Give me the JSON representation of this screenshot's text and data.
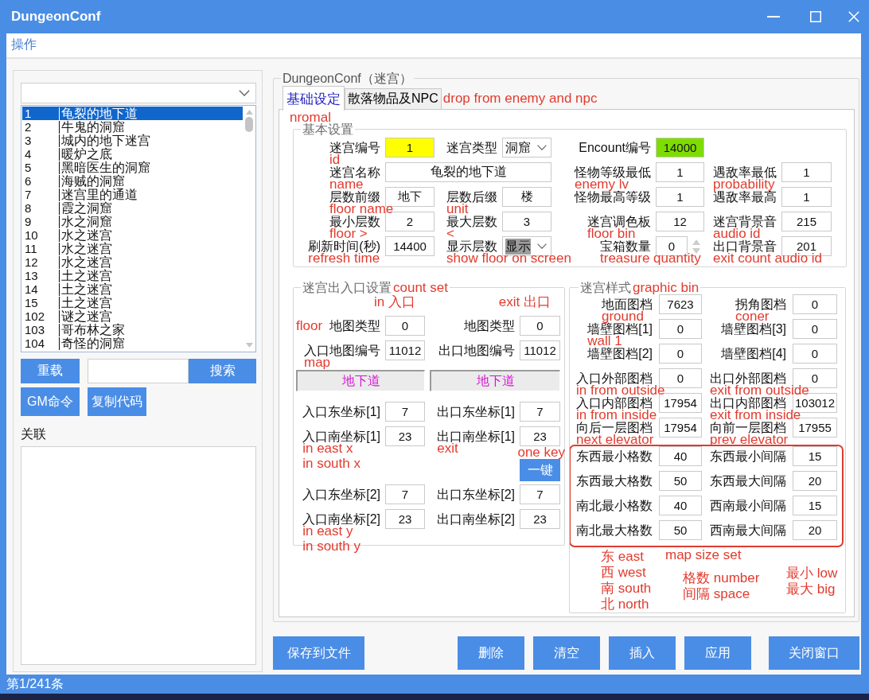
{
  "window": {
    "title": "DungeonConf"
  },
  "menu": [
    {
      "label": "操作"
    }
  ],
  "dungeon_list": {
    "rows": [
      {
        "id": "1",
        "name": "龟裂的地下道",
        "selected": true
      },
      {
        "id": "2",
        "name": "牛鬼的洞窟",
        "selected": false
      },
      {
        "id": "3",
        "name": "城内的地下迷宫",
        "selected": false
      },
      {
        "id": "4",
        "name": "暖炉之底",
        "selected": false
      },
      {
        "id": "5",
        "name": "黑暗医生的洞窟",
        "selected": false
      },
      {
        "id": "6",
        "name": "海贼的洞窟",
        "selected": false
      },
      {
        "id": "7",
        "name": "迷宫里的通道",
        "selected": false
      },
      {
        "id": "8",
        "name": "霞之洞窟",
        "selected": false
      },
      {
        "id": "9",
        "name": "水之洞窟",
        "selected": false
      },
      {
        "id": "10",
        "name": "水之迷宫",
        "selected": false
      },
      {
        "id": "11",
        "name": "水之迷宫",
        "selected": false
      },
      {
        "id": "12",
        "name": "水之迷宫",
        "selected": false
      },
      {
        "id": "13",
        "name": "土之迷宫",
        "selected": false
      },
      {
        "id": "14",
        "name": "土之迷宫",
        "selected": false
      },
      {
        "id": "15",
        "name": "土之迷宫",
        "selected": false
      },
      {
        "id": "102",
        "name": "谜之迷宫",
        "selected": false
      },
      {
        "id": "103",
        "name": "哥布林之家",
        "selected": false
      },
      {
        "id": "104",
        "name": "奇怪的洞窟",
        "selected": false
      }
    ]
  },
  "list_controls": {
    "reload": "重载",
    "search_button": "搜索",
    "buttons": [
      "GM命令",
      "复制代码"
    ]
  },
  "related": {
    "label": "关联"
  },
  "config": {
    "title": "DungeonConf（迷宫）",
    "tabs": [
      {
        "label": "基础设定",
        "selected": true,
        "notes": [
          "nromal"
        ]
      },
      {
        "label": "散落物品及NPC",
        "selected": false,
        "notes": [
          "drop from enemy and npc"
        ]
      }
    ],
    "basic": {
      "title": "基本设置",
      "rows": [
        {
          "left": [
            {
              "kind": "text",
              "label": "迷宫编号",
              "value": "1",
              "color": "#ffff00",
              "notes": [
                "id"
              ]
            },
            {
              "kind": "combo",
              "label": "迷宫类型",
              "value": "洞窟",
              "highlighted": false
            }
          ],
          "right": [
            {
              "kind": "text",
              "label": "Encount编号",
              "value": "14000",
              "color": "#7fdc00"
            }
          ]
        },
        {
          "left": [
            {
              "kind": "wide",
              "label": "迷宫名称",
              "value": "龟裂的地下道",
              "notes": [
                "name"
              ]
            }
          ],
          "right": [
            {
              "kind": "text",
              "label": "怪物等级最低",
              "value": "1",
              "notes": [
                "enemy lv"
              ]
            },
            {
              "kind": "text",
              "label": "遇敌率最低",
              "value": "1",
              "notes": [
                "probability"
              ]
            }
          ]
        },
        {
          "left": [
            {
              "kind": "text",
              "label": "层数前缀",
              "value": "地下",
              "notes": [
                "floor name"
              ]
            },
            {
              "kind": "text",
              "label": "层数后缀",
              "value": "楼",
              "notes": [
                "unit"
              ]
            }
          ],
          "right": [
            {
              "kind": "text",
              "label": "怪物最高等级",
              "value": "1"
            },
            {
              "kind": "text",
              "label": "遇敌率最高",
              "value": "1"
            }
          ]
        },
        {
          "left": [
            {
              "kind": "text",
              "label": "最小层数",
              "value": "2",
              "notes": [
                "floor >"
              ]
            },
            {
              "kind": "text",
              "label": "最大层数",
              "value": "3",
              "notes": [
                "<"
              ]
            }
          ],
          "right": [
            {
              "kind": "text",
              "label": "迷宫调色板",
              "value": "12",
              "notes": [
                "floor bin"
              ]
            },
            {
              "kind": "text",
              "label": "迷宫背景音",
              "value": "215",
              "notes": [
                "audio id"
              ]
            }
          ]
        },
        {
          "left": [
            {
              "kind": "text",
              "label": "刷新时间(秒)",
              "value": "14400",
              "notes": [
                "refresh time"
              ]
            },
            {
              "kind": "combo",
              "label": "显示层数",
              "value": "显示",
              "highlighted": true,
              "notes": [
                "show floor on screen"
              ]
            }
          ],
          "right": [
            {
              "kind": "spin",
              "label": "宝箱数量",
              "value": "0",
              "notes": [
                "treasure quantity"
              ]
            },
            {
              "kind": "text",
              "label": "出口背景音",
              "value": "201",
              "notes": [
                "exit count audio id"
              ]
            }
          ]
        }
      ]
    },
    "entrance_exit": {
      "title": "迷宫出入口设置",
      "title_note": "count set",
      "column_notes": [
        "in 入口",
        "exit 出口"
      ],
      "rows": [
        {
          "kind": "fields",
          "cells": [
            {
              "label": "地图类型",
              "value": "0",
              "side_note": "floor"
            },
            {
              "label": "地图类型",
              "value": "0"
            }
          ]
        },
        {
          "kind": "fields",
          "cells": [
            {
              "label": "入口地图编号",
              "value": "11012",
              "notes": [
                "map"
              ]
            },
            {
              "label": "出口地图编号",
              "value": "11012"
            }
          ]
        },
        {
          "kind": "map_names",
          "cells": [
            {
              "value": "地下道"
            },
            {
              "value": "地下道"
            }
          ]
        },
        {
          "kind": "fields",
          "cells": [
            {
              "label": "入口东坐标[1]",
              "value": "7"
            },
            {
              "label": "出口东坐标[1]",
              "value": "7"
            }
          ]
        },
        {
          "kind": "fields",
          "cells": [
            {
              "label": "入口南坐标[1]",
              "value": "23",
              "notes": [
                "in east x",
                "in south x"
              ]
            },
            {
              "label": "出口南坐标[1]",
              "value": "23",
              "notes": [
                "exit"
              ]
            }
          ]
        },
        {
          "kind": "button",
          "label": "一键",
          "notes": [
            "one key"
          ]
        },
        {
          "kind": "fields",
          "cells": [
            {
              "label": "入口东坐标[2]",
              "value": "7"
            },
            {
              "label": "出口东坐标[2]",
              "value": "7"
            }
          ]
        },
        {
          "kind": "fields",
          "cells": [
            {
              "label": "入口南坐标[2]",
              "value": "23",
              "notes": [
                "in east y",
                "in south y"
              ]
            },
            {
              "label": "出口南坐标[2]",
              "value": "23"
            }
          ]
        }
      ]
    },
    "style": {
      "title": "迷宫样式",
      "title_note": "graphic bin",
      "rows": [
        {
          "cells": [
            {
              "label": "地面图档",
              "value": "7623",
              "notes": [
                "ground"
              ]
            },
            {
              "label": "拐角图档",
              "value": "0",
              "notes": [
                "coner"
              ]
            }
          ]
        },
        {
          "cells": [
            {
              "label": "墙壁图档[1]",
              "value": "0",
              "notes": [
                "wall 1"
              ]
            },
            {
              "label": "墙壁图档[3]",
              "value": "0"
            }
          ]
        },
        {
          "cells": [
            {
              "label": "墙壁图档[2]",
              "value": "0"
            },
            {
              "label": "墙壁图档[4]",
              "value": "0"
            }
          ]
        },
        {
          "cells": [
            {
              "label": "入口外部图档",
              "value": "0",
              "notes": [
                "in from outside"
              ]
            },
            {
              "label": "出口外部图档",
              "value": "0",
              "notes": [
                "exit from outside"
              ]
            }
          ]
        },
        {
          "cells": [
            {
              "label": "入口内部图档",
              "value": "17954",
              "notes": [
                "in from inside"
              ]
            },
            {
              "label": "出口内部图档",
              "value": "103012",
              "notes": [
                "exit from inside"
              ]
            }
          ]
        },
        {
          "cells": [
            {
              "label": "向后一层图档",
              "value": "17954",
              "notes": [
                "next elevator"
              ]
            },
            {
              "label": "向前一层图档",
              "value": "17955",
              "notes": [
                "prev elevator"
              ]
            }
          ]
        }
      ],
      "map_size": {
        "note": "map size set",
        "rows": [
          {
            "cells": [
              {
                "label": "东西最小格数",
                "value": "40"
              },
              {
                "label": "东西最小间隔",
                "value": "15"
              }
            ]
          },
          {
            "cells": [
              {
                "label": "东西最大格数",
                "value": "50"
              },
              {
                "label": "东西最大间隔",
                "value": "20"
              }
            ]
          },
          {
            "cells": [
              {
                "label": "南北最小格数",
                "value": "40"
              },
              {
                "label": "西南最小间隔",
                "value": "15"
              }
            ]
          },
          {
            "cells": [
              {
                "label": "南北最大格数",
                "value": "50"
              },
              {
                "label": "西南最大间隔",
                "value": "20"
              }
            ]
          }
        ]
      },
      "legend": [
        {
          "lines": [
            "东 east",
            "西 west",
            "南 south",
            "北 north"
          ]
        },
        {
          "lines": [
            "格数 number",
            "间隔 space"
          ]
        },
        {
          "lines": [
            "最小 low",
            "最大 big"
          ]
        }
      ]
    }
  },
  "actions": {
    "left": [
      "保存到文件"
    ],
    "right": [
      "删除",
      "清空",
      "插入",
      "应用",
      "关闭窗口"
    ]
  },
  "status_bar": {
    "text": "第1/241条"
  }
}
